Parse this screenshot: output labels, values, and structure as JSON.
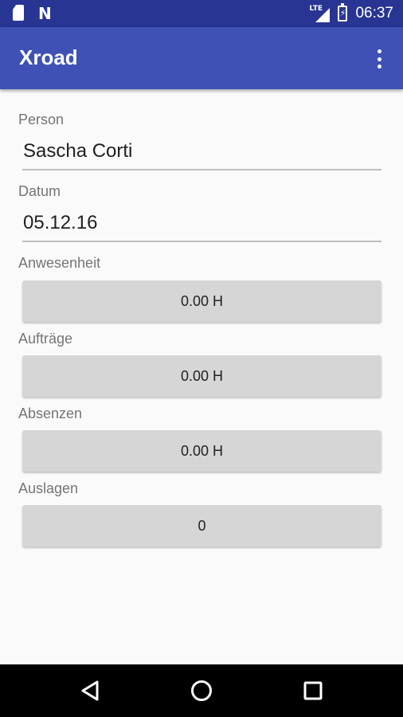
{
  "status_bar": {
    "time": "06:37",
    "network": "LTE",
    "icons": [
      "sd-card-icon",
      "n-notification-icon",
      "lte-signal-icon",
      "battery-charging-icon"
    ]
  },
  "app_bar": {
    "title": "Xroad",
    "overflow_icon": "more-vert-icon",
    "color": "#3f51b5"
  },
  "form": {
    "person_label": "Person",
    "person_value": "Sascha Corti",
    "datum_label": "Datum",
    "datum_value": "05.12.16",
    "anwesenheit_label": "Anwesenheit",
    "anwesenheit_value": "0.00 H",
    "auftraege_label": "Aufträge",
    "auftraege_value": "0.00 H",
    "absenzen_label": "Absenzen",
    "absenzen_value": "0.00 H",
    "auslagen_label": "Auslagen",
    "auslagen_value": "0"
  },
  "nav_bar": {
    "buttons": [
      "back-icon",
      "home-icon",
      "recents-icon"
    ]
  },
  "colors": {
    "status_bar": "#283593",
    "app_bar": "#3f51b5",
    "background": "#fafafa",
    "button": "#d6d6d6"
  }
}
